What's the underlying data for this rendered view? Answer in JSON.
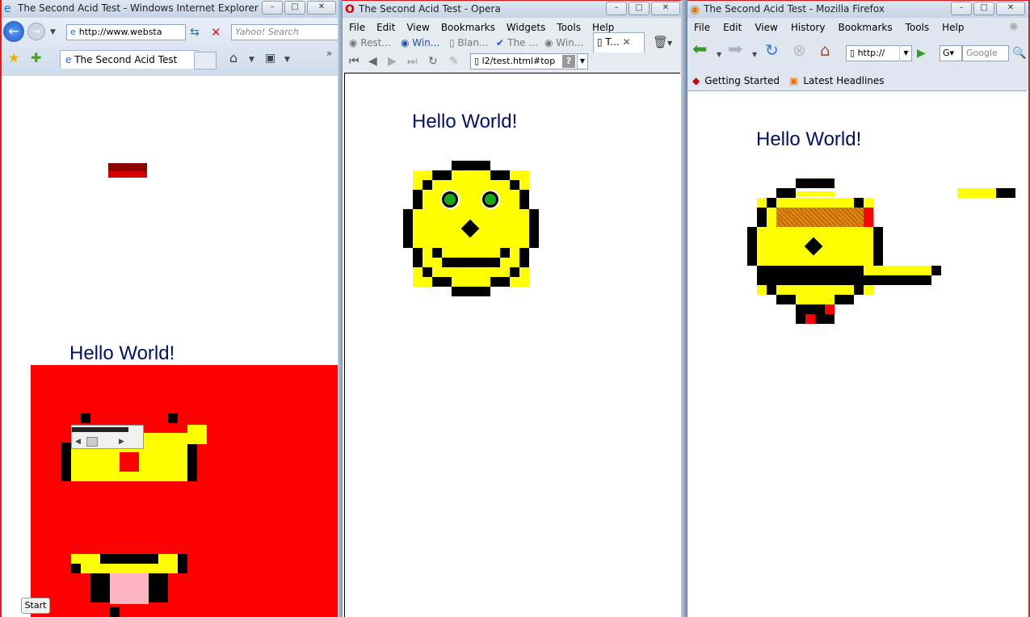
{
  "ie": {
    "title": "The Second Acid Test - Windows Internet Explorer",
    "address": "http://www.websta",
    "search_placeholder": "Yahoo! Search",
    "tab_label": "The Second Acid Test",
    "hello": "Hello World!",
    "start_button": "Start"
  },
  "opera": {
    "title": "The Second Acid Test - Opera",
    "menu": [
      "File",
      "Edit",
      "View",
      "Bookmarks",
      "Widgets",
      "Tools",
      "Help"
    ],
    "tabs": [
      "Rest...",
      "Win...",
      "Blan...",
      "The ...",
      "Win...",
      "T..."
    ],
    "address": "l2/test.html#top",
    "hello": "Hello World!"
  },
  "firefox": {
    "title": "The Second Acid Test - Mozilla Firefox",
    "menu": [
      "File",
      "Edit",
      "View",
      "History",
      "Bookmarks",
      "Tools",
      "Help"
    ],
    "address": "http://",
    "search_placeholder": "Google",
    "bookmarks": [
      "Getting Started",
      "Latest Headlines"
    ],
    "hello": "Hello World!"
  },
  "colors": {
    "yellow": "#ffff00",
    "red": "#ff0000",
    "black": "#000000",
    "text_blue": "#001068",
    "frame_red": "#e31b1b"
  }
}
